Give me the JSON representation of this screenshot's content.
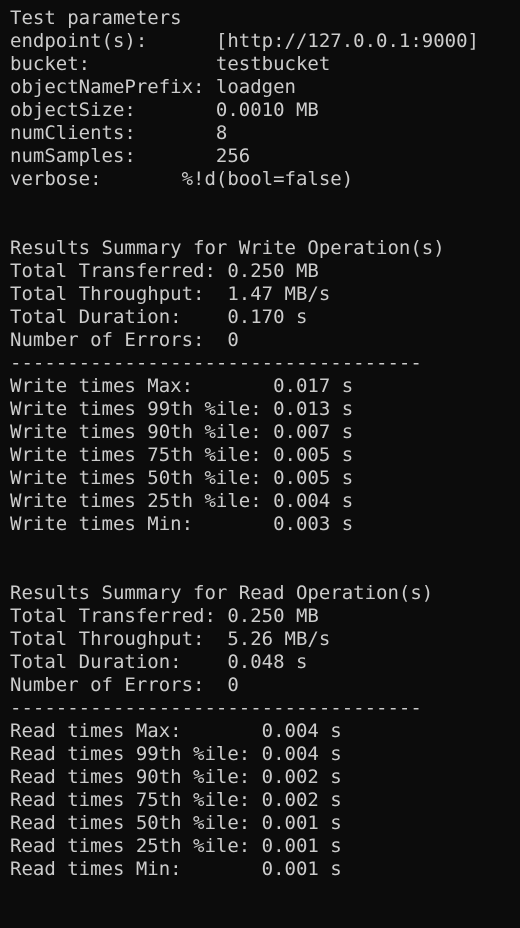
{
  "terminal": {
    "lines": [
      "Test parameters",
      "endpoint(s):      [http://127.0.0.1:9000]",
      "bucket:           testbucket",
      "objectNamePrefix: loadgen",
      "objectSize:       0.0010 MB",
      "numClients:       8",
      "numSamples:       256",
      "verbose:       %!d(bool=false)",
      "",
      "",
      "Results Summary for Write Operation(s)",
      "Total Transferred: 0.250 MB",
      "Total Throughput:  1.47 MB/s",
      "Total Duration:    0.170 s",
      "Number of Errors:  0",
      "------------------------------------",
      "Write times Max:       0.017 s",
      "Write times 99th %ile: 0.013 s",
      "Write times 90th %ile: 0.007 s",
      "Write times 75th %ile: 0.005 s",
      "Write times 50th %ile: 0.005 s",
      "Write times 25th %ile: 0.004 s",
      "Write times Min:       0.003 s",
      "",
      "",
      "Results Summary for Read Operation(s)",
      "Total Transferred: 0.250 MB",
      "Total Throughput:  5.26 MB/s",
      "Total Duration:    0.048 s",
      "Number of Errors:  0",
      "------------------------------------",
      "Read times Max:       0.004 s",
      "Read times 99th %ile: 0.004 s",
      "Read times 90th %ile: 0.002 s",
      "Read times 75th %ile: 0.002 s",
      "Read times 50th %ile: 0.001 s",
      "Read times 25th %ile: 0.001 s",
      "Read times Min:       0.001 s"
    ]
  }
}
